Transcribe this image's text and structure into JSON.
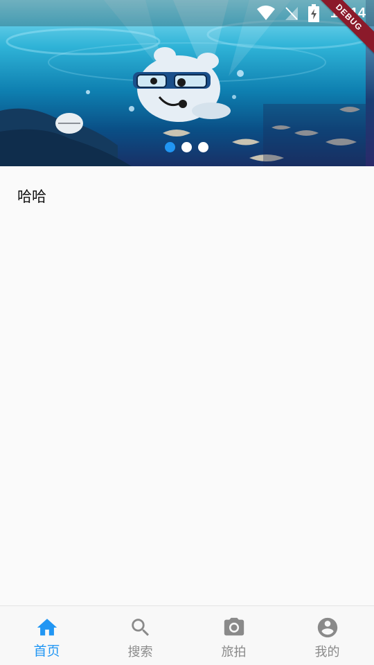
{
  "status_bar": {
    "time": "10:14",
    "debug_label": "DEBUG",
    "icons": [
      "wifi-icon",
      "no-signal-icon",
      "battery-charging-icon"
    ]
  },
  "banner": {
    "image": "underwater-cartoon-diver",
    "dots_total": 3,
    "active_index": 0
  },
  "content": {
    "text": "哈哈"
  },
  "bottom_nav": {
    "active_color": "#2196f3",
    "inactive_color": "#8a8a8a",
    "items": [
      {
        "label": "首页",
        "icon": "home-icon",
        "active": true
      },
      {
        "label": "搜索",
        "icon": "search-icon",
        "active": false
      },
      {
        "label": "旅拍",
        "icon": "camera-icon",
        "active": false
      },
      {
        "label": "我的",
        "icon": "account-icon",
        "active": false
      }
    ]
  }
}
